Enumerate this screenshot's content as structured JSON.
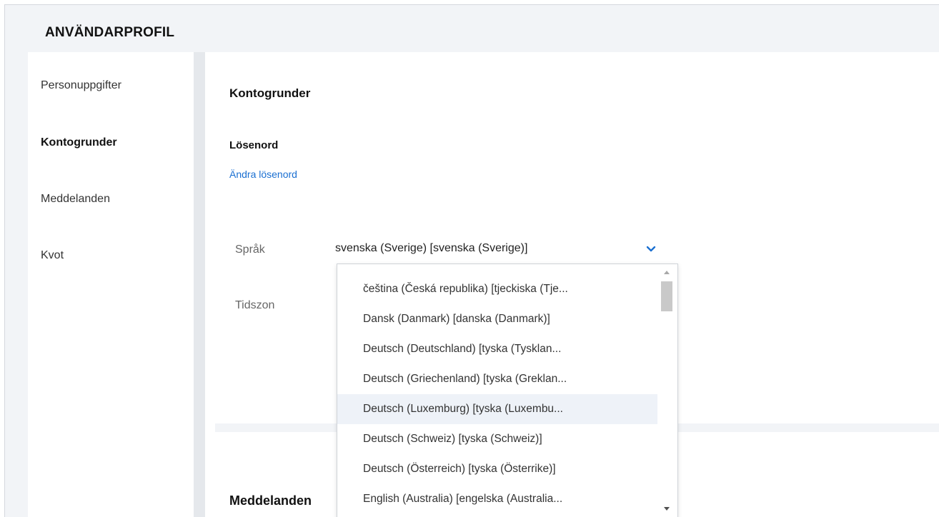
{
  "page": {
    "title": "ANVÄNDARPROFIL"
  },
  "sidebar": {
    "items": [
      {
        "label": "Personuppgifter",
        "active": false
      },
      {
        "label": "Kontogrunder",
        "active": true
      },
      {
        "label": "Meddelanden",
        "active": false
      },
      {
        "label": "Kvot",
        "active": false
      }
    ]
  },
  "main": {
    "section_title": "Kontogrunder",
    "password": {
      "heading": "Lösenord",
      "change_link": "Ändra lösenord"
    },
    "language": {
      "label": "Språk",
      "selected": "svenska (Sverige)   [svenska (Sverige)]",
      "options": [
        "čeština (Česká republika) [tjeckiska (Tje...",
        "Dansk (Danmark) [danska (Danmark)]",
        "Deutsch (Deutschland) [tyska (Tysklan...",
        "Deutsch (Griechenland) [tyska (Greklan...",
        "Deutsch (Luxemburg) [tyska (Luxembu...",
        "Deutsch (Schweiz) [tyska (Schweiz)]",
        "Deutsch (Österreich) [tyska (Österrike)]",
        "English (Australia) [engelska (Australia..."
      ],
      "hovered_option": 4
    },
    "timezone": {
      "label": "Tidszon"
    },
    "notifications_title": "Meddelanden"
  },
  "icons": {
    "dropdown": "chevron-down-icon",
    "scroll_up": "scroll-up-arrow-icon",
    "scroll_down": "scroll-down-arrow-icon"
  },
  "colors": {
    "accent": "#1a6fd1",
    "background": "#f2f4f7",
    "hover": "#eef2f8"
  }
}
